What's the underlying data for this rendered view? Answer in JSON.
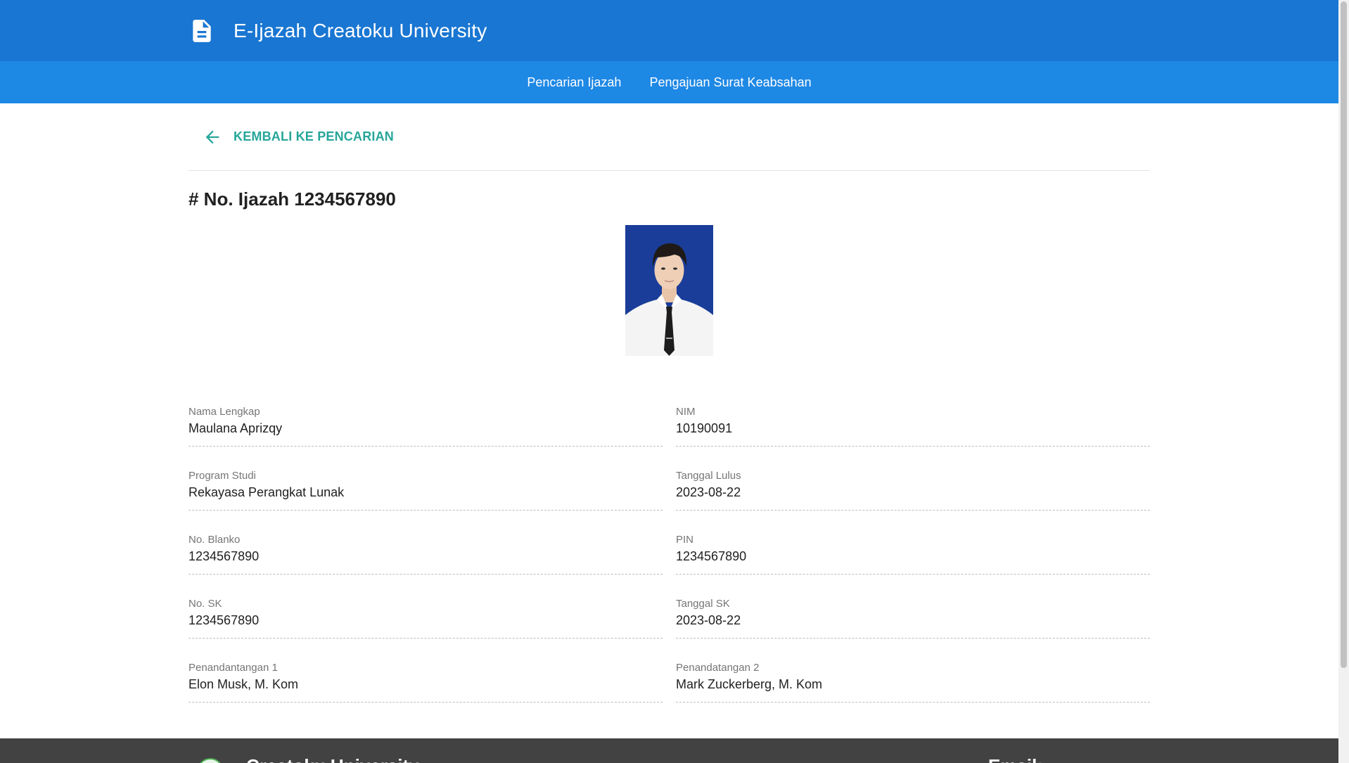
{
  "header": {
    "icon": "document-icon",
    "title": "E-Ijazah Creatoku University"
  },
  "nav": {
    "items": [
      {
        "label": "Pencarian Ijazah"
      },
      {
        "label": "Pengajuan Surat Keabsahan"
      }
    ]
  },
  "back": {
    "icon": "arrow-left-icon",
    "label": "KEMBALI KE PENCARIAN"
  },
  "page": {
    "title": "# No. Ijazah 1234567890"
  },
  "fields": [
    {
      "label": "Nama Lengkap",
      "value": "Maulana Aprizqy"
    },
    {
      "label": "NIM",
      "value": "10190091"
    },
    {
      "label": "Program Studi",
      "value": "Rekayasa Perangkat Lunak"
    },
    {
      "label": "Tanggal Lulus",
      "value": "2023-08-22"
    },
    {
      "label": "No. Blanko",
      "value": "1234567890"
    },
    {
      "label": "PIN",
      "value": "1234567890"
    },
    {
      "label": "No. SK",
      "value": "1234567890"
    },
    {
      "label": "Tanggal SK",
      "value": "2023-08-22"
    },
    {
      "label": "Penandantangan 1",
      "value": "Elon Musk, M. Kom"
    },
    {
      "label": "Penandatangan 2",
      "value": "Mark Zuckerberg, M. Kom"
    }
  ],
  "footer": {
    "university": "Creatoku University",
    "email_heading": "Email:"
  },
  "colors": {
    "header_bg": "#1976d2",
    "nav_bg": "#1e88e5",
    "accent": "#26a69a",
    "footer_bg": "#424242"
  }
}
